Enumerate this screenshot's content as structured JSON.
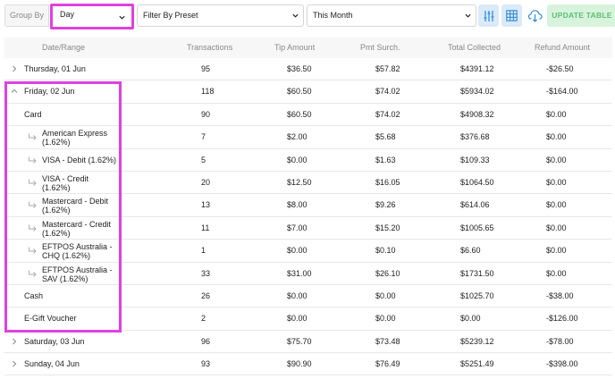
{
  "toolbar": {
    "group_by_label": "Group By",
    "group_by_value": "Day",
    "preset_value": "Filter By Preset",
    "period_value": "This Month",
    "update_label": "UPDATE TABLE"
  },
  "icons": {
    "sliders": "sliders-icon",
    "grid": "table-grid-icon",
    "cloud": "cloud-download-icon",
    "chevron": "chevron-down-icon"
  },
  "colors": {
    "highlight": "#e040e0",
    "icon_blue": "#3a8fd6",
    "update_text": "#5cbf73",
    "update_bg": "#d7f3dc"
  },
  "table": {
    "headers": [
      "Date/Range",
      "Transactions",
      "Tip Amount",
      "Pmt Surch.",
      "Total Collected",
      "Refund Amount"
    ],
    "rows": [
      {
        "label": "Thursday, 01 Jun",
        "tx": "95",
        "tip": "$36.50",
        "pmt": "$57.82",
        "total": "$4391.12",
        "refund": "-$26.50"
      },
      {
        "label": "Friday, 02 Jun",
        "tx": "118",
        "tip": "$60.50",
        "pmt": "$74.02",
        "total": "$5934.02",
        "refund": "-$164.00"
      },
      {
        "label": "Card",
        "tx": "90",
        "tip": "$60.50",
        "pmt": "$74.02",
        "total": "$4908.32",
        "refund": "$0.00"
      },
      {
        "label1": "American Express",
        "label2": "(1.62%)",
        "tx": "7",
        "tip": "$2.00",
        "pmt": "$5.68",
        "total": "$376.68",
        "refund": "$0.00"
      },
      {
        "label": "VISA - Debit (1.62%)",
        "tx": "5",
        "tip": "$0.00",
        "pmt": "$1.63",
        "total": "$109.33",
        "refund": "$0.00"
      },
      {
        "label1": "VISA - Credit",
        "label2": "(1.62%)",
        "tx": "20",
        "tip": "$12.50",
        "pmt": "$16.05",
        "total": "$1064.50",
        "refund": "$0.00"
      },
      {
        "label1": "Mastercard - Debit",
        "label2": "(1.62%)",
        "tx": "13",
        "tip": "$8.00",
        "pmt": "$9.26",
        "total": "$614.06",
        "refund": "$0.00"
      },
      {
        "label1": "Mastercard - Credit",
        "label2": "(1.62%)",
        "tx": "11",
        "tip": "$7.00",
        "pmt": "$15.20",
        "total": "$1005.65",
        "refund": "$0.00"
      },
      {
        "label1": "EFTPOS Australia -",
        "label2": "CHQ (1.62%)",
        "tx": "1",
        "tip": "$0.00",
        "pmt": "$0.10",
        "total": "$6.60",
        "refund": "$0.00"
      },
      {
        "label1": "EFTPOS Australia -",
        "label2": "SAV (1.62%)",
        "tx": "33",
        "tip": "$31.00",
        "pmt": "$26.10",
        "total": "$1731.50",
        "refund": "$0.00"
      },
      {
        "label": "Cash",
        "tx": "26",
        "tip": "$0.00",
        "pmt": "$0.00",
        "total": "$1025.70",
        "refund": "-$38.00"
      },
      {
        "label": "E-Gift Voucher",
        "tx": "2",
        "tip": "$0.00",
        "pmt": "$0.00",
        "total": "$0.00",
        "refund": "-$126.00"
      },
      {
        "label": "Saturday, 03 Jun",
        "tx": "96",
        "tip": "$75.70",
        "pmt": "$73.48",
        "total": "$5239.12",
        "refund": "-$78.00"
      },
      {
        "label": "Sunday, 04 Jun",
        "tx": "93",
        "tip": "$90.90",
        "pmt": "$76.49",
        "total": "$5251.49",
        "refund": "-$398.00"
      }
    ]
  }
}
